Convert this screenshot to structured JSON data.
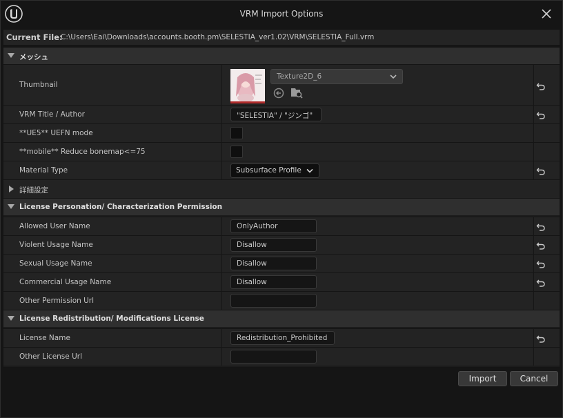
{
  "window": {
    "title": "VRM Import Options",
    "current_file_label": "Current File:",
    "current_file_path": "C:\\Users\\Eai\\Downloads\\accounts.booth.pm\\SELESTIA_ver1.02\\VRM\\SELESTIA_Full.vrm"
  },
  "mesh_section": {
    "title": "メッシュ",
    "thumbnail_label": "Thumbnail",
    "thumbnail_texture": "Texture2D_6",
    "vrm_title_label": "VRM Title / Author",
    "vrm_title_value": "\"SELESTIA\" / \"ジンゴ\"",
    "uefn_label": "**UE5** UEFN mode",
    "uefn_checked": false,
    "reduce_bonemap_label": "**mobile** Reduce bonemap<=75",
    "reduce_bonemap_checked": false,
    "material_type_label": "Material Type",
    "material_type_value": "Subsurface Profile"
  },
  "advanced": {
    "label": "詳細設定"
  },
  "license_persona": {
    "title": "License Personation/ Characterization Permission",
    "allowed_user_label": "Allowed User Name",
    "allowed_user_value": "OnlyAuthor",
    "violent_label": "Violent Usage Name",
    "violent_value": "Disallow",
    "sexual_label": "Sexual Usage Name",
    "sexual_value": "Disallow",
    "commercial_label": "Commercial Usage Name",
    "commercial_value": "Disallow",
    "other_permission_label": "Other Permission Url",
    "other_permission_value": ""
  },
  "license_redist": {
    "title": "License Redistribution/ Modifications License",
    "license_name_label": "License Name",
    "license_name_value": "Redistribution_Prohibited",
    "other_license_label": "Other License Url",
    "other_license_value": ""
  },
  "buttons": {
    "import": "Import",
    "cancel": "Cancel"
  },
  "colors": {
    "background": "#151515",
    "category": "#2f2f2f",
    "row": "#232323",
    "accent_red": "#b02b2b"
  }
}
